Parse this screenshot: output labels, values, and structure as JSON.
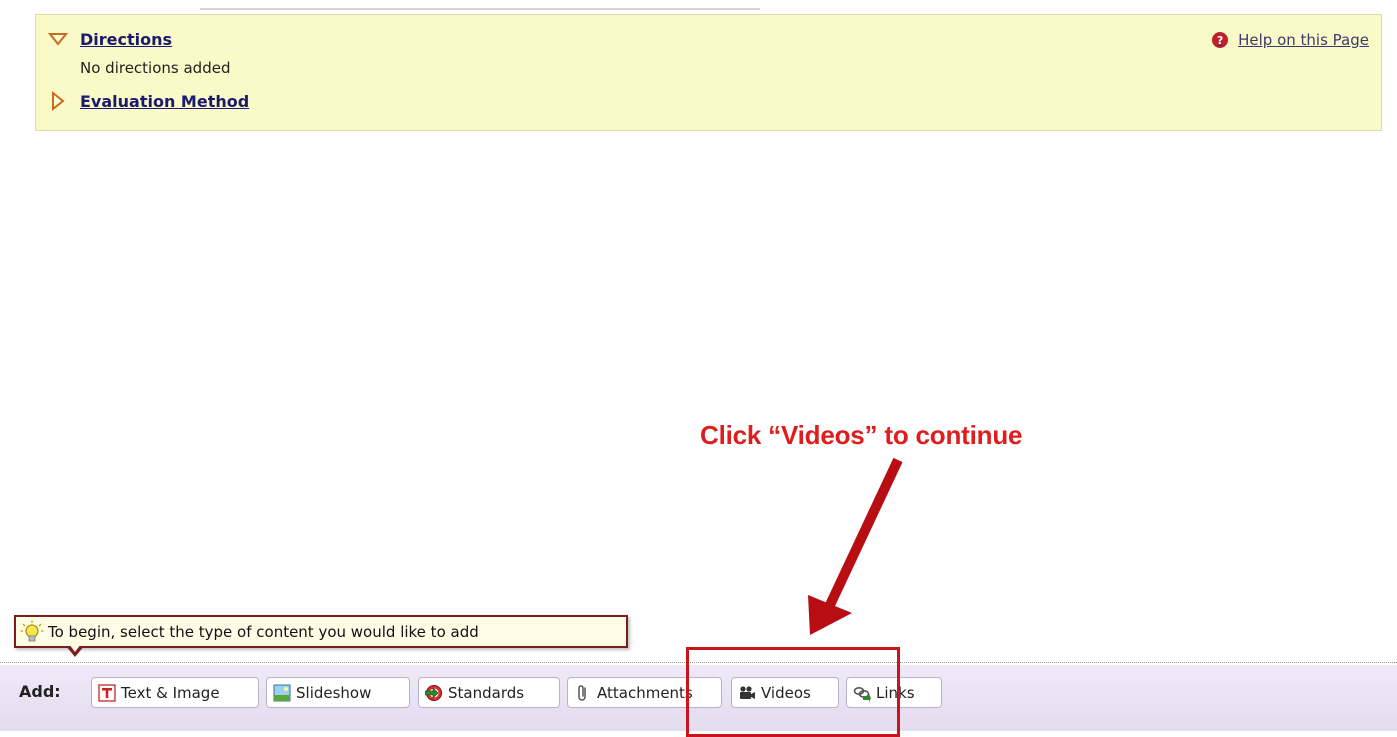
{
  "directions": {
    "directions_link": "Directions",
    "directions_text": "No directions added",
    "evaluation_link": "Evaluation Method",
    "help_link": "Help on this Page",
    "help_icon_glyph": "?"
  },
  "annotation": {
    "instruction": "Click “Videos” to continue",
    "color": "#e01d1d"
  },
  "tooltip": {
    "text": "To begin, select the type of content you would like to add"
  },
  "toolbar": {
    "add_label": "Add:",
    "buttons": [
      {
        "label": "Text & Image",
        "icon": "text-image-icon"
      },
      {
        "label": "Slideshow",
        "icon": "slideshow-icon"
      },
      {
        "label": "Standards",
        "icon": "standards-icon"
      },
      {
        "label": "Attachments",
        "icon": "paperclip-icon"
      },
      {
        "label": "Videos",
        "icon": "video-camera-icon"
      },
      {
        "label": "Links",
        "icon": "link-chain-icon"
      }
    ]
  }
}
